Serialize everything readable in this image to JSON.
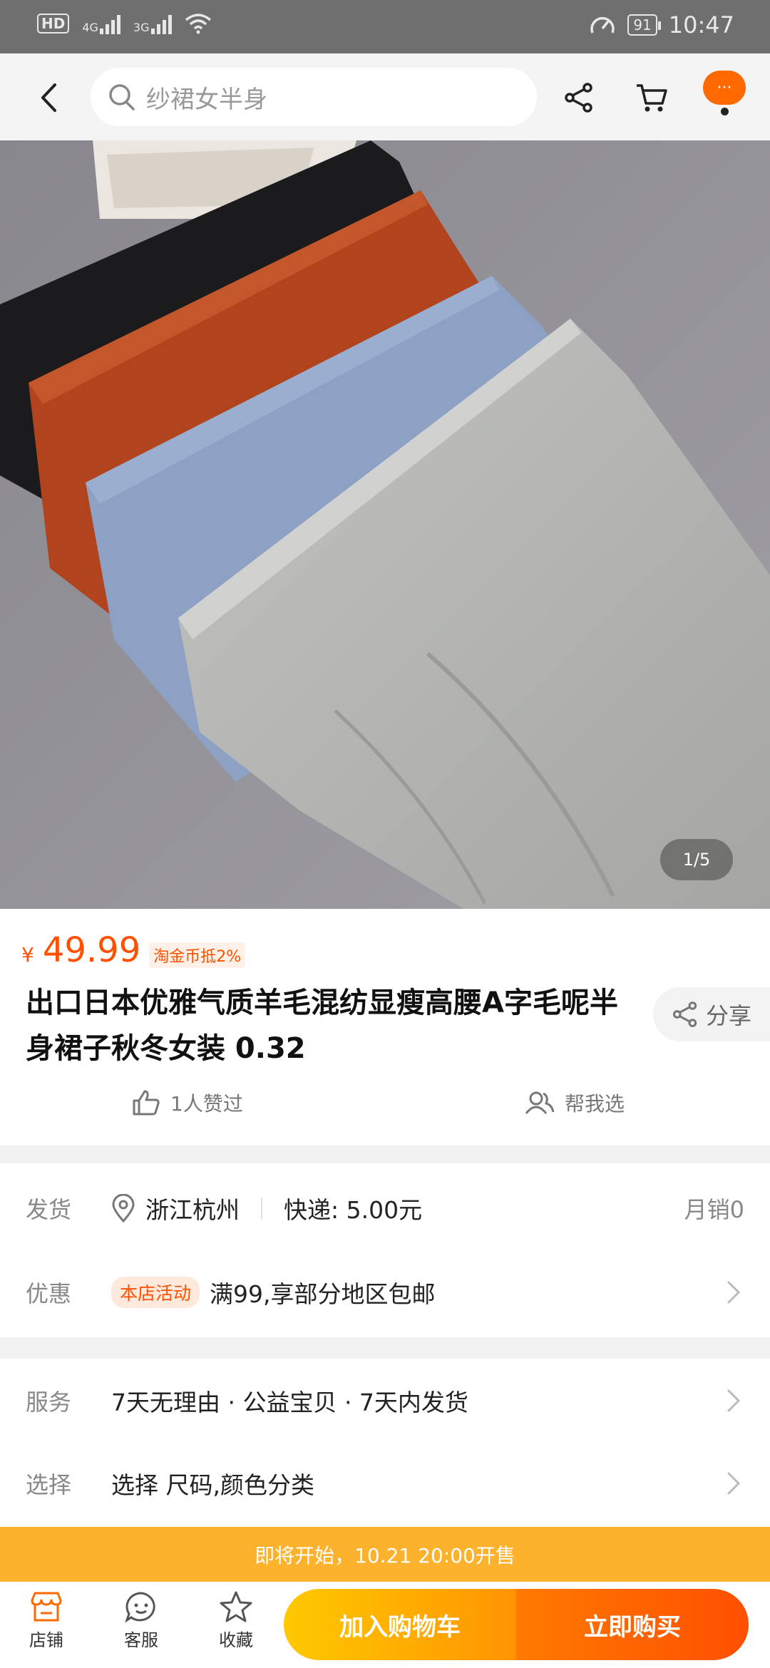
{
  "status_bar": {
    "hd": "HD",
    "sim1": "4G",
    "sim2": "3G",
    "battery": "91",
    "time": "10:47"
  },
  "search": {
    "placeholder": "纱裙女半身"
  },
  "top_nav": {
    "more_label": "···",
    "icons": [
      "back-icon",
      "search-icon",
      "share-icon",
      "cart-icon",
      "more-icon"
    ]
  },
  "gallery": {
    "pager": "1/5"
  },
  "product": {
    "currency": "¥",
    "price": "49.99",
    "coin_tag": "淘金币抵2%",
    "title": "出口日本优雅气质羊毛混纺显瘦高腰A字毛呢半身裙子秋冬女装 0.32",
    "share_label": "分享",
    "likes_label": "1人赞过",
    "help_choose_label": "帮我选"
  },
  "shipping": {
    "label": "发货",
    "location": "浙江杭州",
    "express": "快递: 5.00元",
    "monthly_sales": "月销0"
  },
  "promo": {
    "label": "优惠",
    "tag": "本店活动",
    "text": "满99,享部分地区包邮"
  },
  "service": {
    "label": "服务",
    "text": "7天无理由 · 公益宝贝 · 7天内发货"
  },
  "select": {
    "label": "选择",
    "text": "选择 尺码,颜色分类"
  },
  "presale_banner": "即将开始，10.21 20:00开售",
  "bottom_bar": {
    "shop": "店铺",
    "service": "客服",
    "favorite": "收藏",
    "add_to_cart": "加入购物车",
    "buy_now": "立即购买"
  },
  "colors": {
    "accent": "#ff5000",
    "banner": "#fdb22e"
  }
}
